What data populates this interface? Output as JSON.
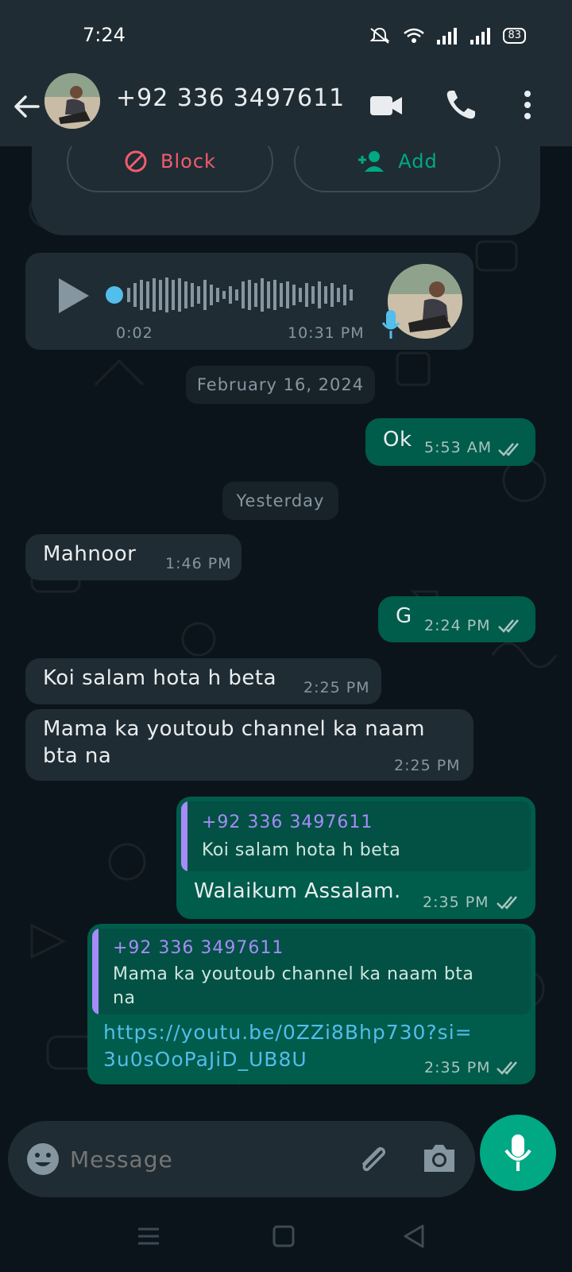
{
  "status_bar": {
    "time": "7:24",
    "battery": "83"
  },
  "header": {
    "contact": "+92 336 3497611"
  },
  "actions": {
    "block_label": "Block",
    "add_label": "Add"
  },
  "voice_note": {
    "duration": "0:02",
    "time": "10:31 PM"
  },
  "dates": {
    "first": "February 16, 2024",
    "second": "Yesterday"
  },
  "messages": [
    {
      "dir": "out",
      "text": "Ok",
      "time": "5:53 AM"
    },
    {
      "dir": "in",
      "text": "Mahnoor",
      "time": "1:46 PM"
    },
    {
      "dir": "out",
      "text": "G",
      "time": "2:24 PM"
    },
    {
      "dir": "in",
      "text": "Koi salam hota h beta",
      "time": "2:25 PM"
    },
    {
      "dir": "in",
      "text_line1": "Mama ka youtoub channel ka naam",
      "text_line2": "bta na",
      "time": "2:25 PM"
    },
    {
      "dir": "out",
      "quote_name": "+92 336 3497611",
      "quote_text": "Koi salam hota h beta",
      "text": "Walaikum Assalam.",
      "time": "2:35 PM"
    },
    {
      "dir": "out",
      "quote_name": "+92 336 3497611",
      "quote_line1": "Mama ka youtoub channel ka naam bta",
      "quote_line2": "na",
      "link_line1": "https://youtu.be/0ZZi8Bhp730?si=",
      "link_line2": "3u0sOoPaJiD_UB8U",
      "time": "2:35 PM"
    }
  ],
  "input": {
    "placeholder": "Message"
  },
  "colors": {
    "header": "#202c33",
    "background": "#0b141a",
    "bubble_in": "#202c33",
    "bubble_out": "#005c4b",
    "accent": "#00a884",
    "link": "#53bdeb",
    "quote_bar": "#a78bfa",
    "block": "#f15c6d"
  },
  "icons": [
    "back-arrow-icon",
    "video-call-icon",
    "phone-icon",
    "more-options-icon",
    "block-icon",
    "add-contact-icon",
    "play-icon",
    "mic-icon",
    "emoji-icon",
    "attach-icon",
    "camera-icon",
    "double-tick-icon",
    "nav-menu-icon",
    "nav-home-icon",
    "nav-back-icon"
  ]
}
